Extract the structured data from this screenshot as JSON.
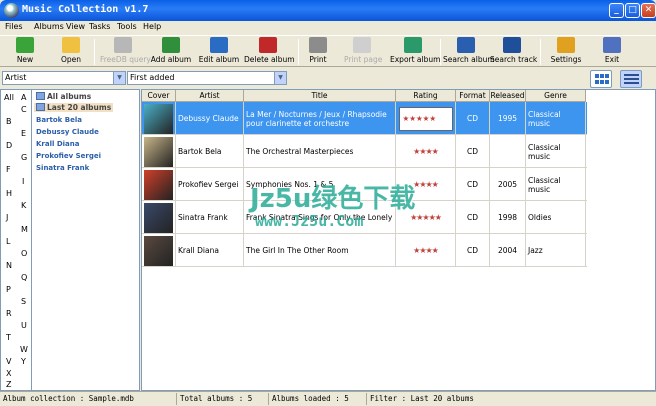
{
  "window": {
    "title": "Music Collection v1.7",
    "minimize_glyph": "_",
    "maximize_glyph": "□",
    "close_glyph": "✕"
  },
  "menu": [
    "Files",
    "Albums",
    "View",
    "Tasks",
    "Tools",
    "Help"
  ],
  "toolbar": [
    {
      "label": "New",
      "icon": "new-icon",
      "color": "#3aa33a",
      "enabled": true
    },
    {
      "label": "Open",
      "icon": "open-icon",
      "color": "#f0c040",
      "enabled": true
    },
    {
      "label": "FreeDB query",
      "icon": "freedb-icon",
      "color": "#b7b7b7",
      "enabled": false
    },
    {
      "label": "Add album",
      "icon": "add-album-icon",
      "color": "#2f8f3a",
      "enabled": true
    },
    {
      "label": "Edit album",
      "icon": "edit-album-icon",
      "color": "#2a6bc4",
      "enabled": true
    },
    {
      "label": "Delete album",
      "icon": "delete-album-icon",
      "color": "#c0282a",
      "enabled": true
    },
    {
      "label": "Print",
      "icon": "print-icon",
      "color": "#8c8c8c",
      "enabled": true
    },
    {
      "label": "Print page",
      "icon": "print-page-icon",
      "color": "#cfcfcf",
      "enabled": false
    },
    {
      "label": "Export album",
      "icon": "export-album-icon",
      "color": "#2a9a6a",
      "enabled": true
    },
    {
      "label": "Search album",
      "icon": "search-album-icon",
      "color": "#2a5fb0",
      "enabled": true
    },
    {
      "label": "Search track",
      "icon": "search-track-icon",
      "color": "#1f4f9a",
      "enabled": true
    },
    {
      "label": "Settings",
      "icon": "settings-icon",
      "color": "#e0a020",
      "enabled": true
    },
    {
      "label": "Exit",
      "icon": "exit-icon",
      "color": "#5070c0",
      "enabled": true
    }
  ],
  "filters": {
    "group_by": "Artist",
    "sort_by": "First added"
  },
  "letters_left": [
    "All",
    "B",
    "D",
    "F",
    "H",
    "J",
    "L",
    "N",
    "P",
    "R",
    "T",
    "V",
    "X",
    "Z"
  ],
  "letters_right": [
    "A",
    "C",
    "E",
    "G",
    "I",
    "K",
    "M",
    "O",
    "Q",
    "S",
    "U",
    "W",
    "Y"
  ],
  "tree": {
    "root": "All albums",
    "last": "Last 20 albums",
    "artists": [
      "Bartok Bela",
      "Debussy Claude",
      "Krall Diana",
      "Prokofiev Sergei",
      "Sinatra Frank"
    ]
  },
  "grid": {
    "columns": [
      "Cover",
      "Artist",
      "Title",
      "Rating",
      "Format",
      "Released",
      "Genre"
    ],
    "rows": [
      {
        "artist": "Debussy Claude",
        "title": "La Mer / Nocturnes / Jeux / Rhapsodie pour clarinette et orchestre",
        "rating": 5,
        "format": "CD",
        "released": "1995",
        "genre": "Classical music",
        "cover_color": "#4ab0c8",
        "selected": true
      },
      {
        "artist": "Bartok Bela",
        "title": "The Orchestral Masterpieces",
        "rating": 4,
        "format": "CD",
        "released": "",
        "genre": "Classical music",
        "cover_color": "#c8b68a",
        "selected": false
      },
      {
        "artist": "Prokofiev Sergei",
        "title": "Symphonies Nos. 1 & 5",
        "rating": 4,
        "format": "CD",
        "released": "2005",
        "genre": "Classical music",
        "cover_color": "#d0402a",
        "selected": false
      },
      {
        "artist": "Sinatra Frank",
        "title": "Frank Sinatra Sings for Only the Lonely",
        "rating": 5,
        "format": "CD",
        "released": "1998",
        "genre": "Oldies",
        "cover_color": "#3a4a6a",
        "selected": false
      },
      {
        "artist": "Krall Diana",
        "title": "The Girl In The Other Room",
        "rating": 4,
        "format": "CD",
        "released": "2004",
        "genre": "Jazz",
        "cover_color": "#5a4a40",
        "selected": false
      }
    ]
  },
  "watermark": {
    "line1": "Jz5u绿色下载",
    "line2": "www.Jz5u.Com"
  },
  "status": {
    "collection": "Album collection : Sample.mdb",
    "total": "Total albums : 5",
    "loaded": "Albums loaded : 5",
    "filter": "Filter : Last 20 albums"
  }
}
